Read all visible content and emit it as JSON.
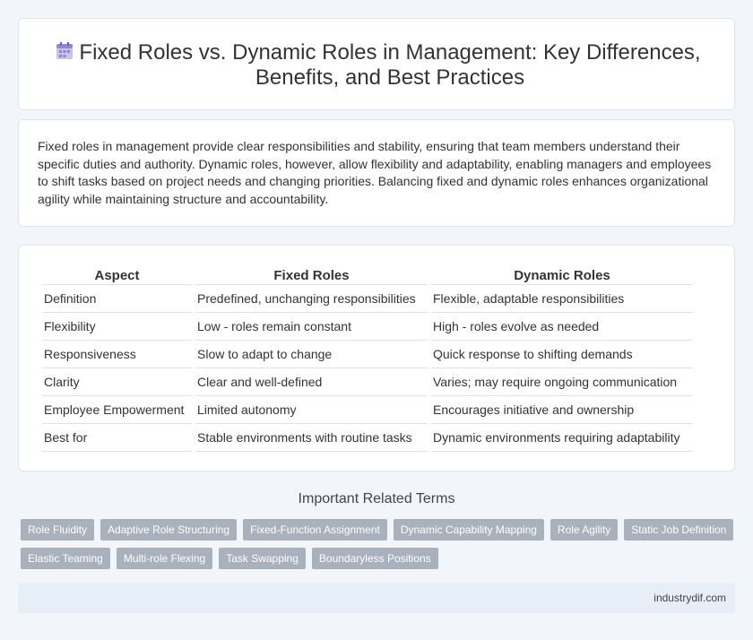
{
  "header": {
    "title": "Fixed Roles vs. Dynamic Roles in Management: Key Differences, Benefits, and Best Practices",
    "icon": "calendar-icon"
  },
  "intro": {
    "text": "Fixed roles in management provide clear responsibilities and stability, ensuring that team members understand their specific duties and authority. Dynamic roles, however, allow flexibility and adaptability, enabling managers and employees to shift tasks based on project needs and changing priorities. Balancing fixed and dynamic roles enhances organizational agility while maintaining structure and accountability."
  },
  "table": {
    "headers": [
      "Aspect",
      "Fixed Roles",
      "Dynamic Roles"
    ],
    "rows": [
      [
        "Definition",
        "Predefined, unchanging responsibilities",
        "Flexible, adaptable responsibilities"
      ],
      [
        "Flexibility",
        "Low - roles remain constant",
        "High - roles evolve as needed"
      ],
      [
        "Responsiveness",
        "Slow to adapt to change",
        "Quick response to shifting demands"
      ],
      [
        "Clarity",
        "Clear and well-defined",
        "Varies; may require ongoing communication"
      ],
      [
        "Employee Empowerment",
        "Limited autonomy",
        "Encourages initiative and ownership"
      ],
      [
        "Best for",
        "Stable environments with routine tasks",
        "Dynamic environments requiring adaptability"
      ]
    ]
  },
  "related": {
    "title": "Important Related Terms",
    "tags_row1": [
      "Role Fluidity",
      "Adaptive Role Structuring",
      "Fixed-Function Assignment",
      "Dynamic Capability Mapping",
      "Role Agility",
      "Static Job Definition"
    ],
    "tags_row2": [
      "Elastic Teaming",
      "Multi-role Flexing",
      "Task Swapping",
      "Boundaryless Positions"
    ]
  },
  "footer": {
    "site": "industrydif.com"
  },
  "colors": {
    "background": "#f2f5fa",
    "tag_bg": "#a9b1bd",
    "footer_bg": "#e7eef8"
  }
}
